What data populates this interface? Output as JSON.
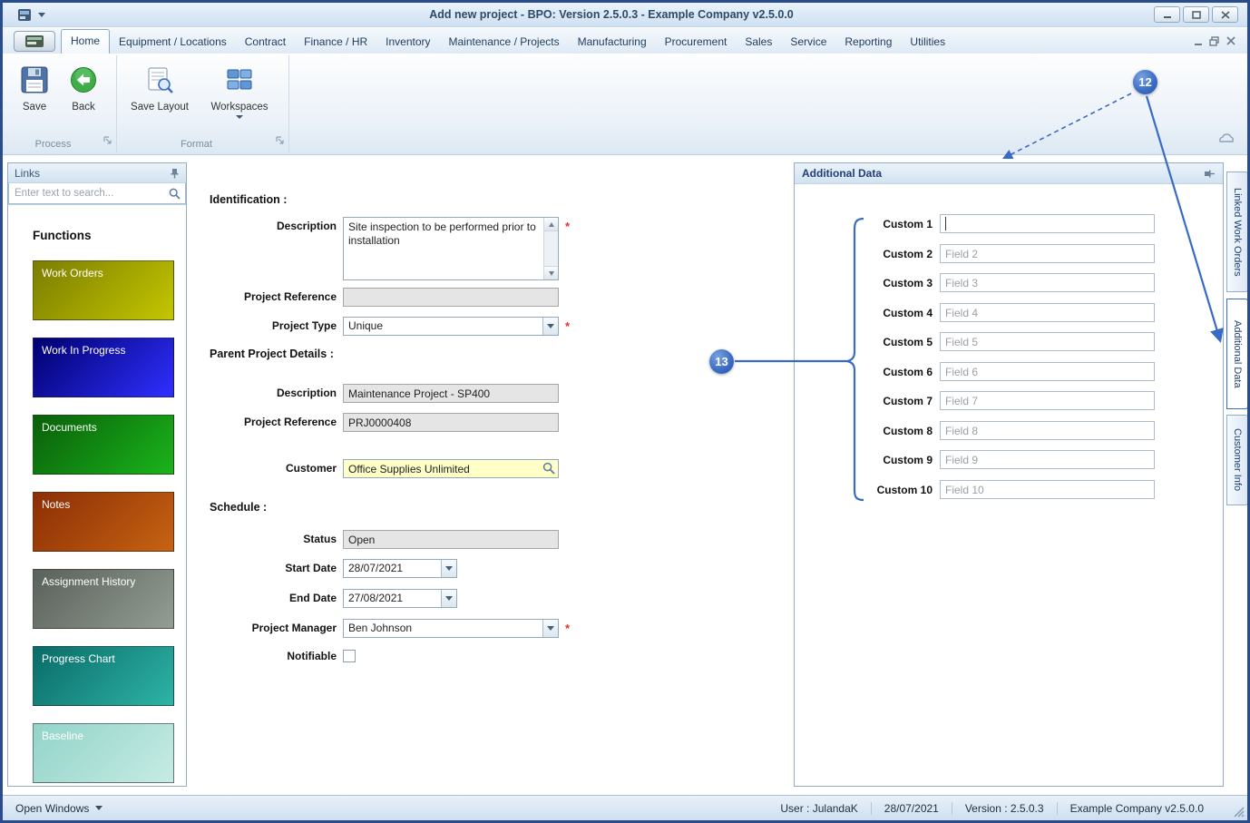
{
  "colors": {
    "annotation_blue": "#3a6bc4",
    "required_red": "#e03232",
    "panel_header_text": "#1f3f77",
    "lookup_yellow": "#ffffc8"
  },
  "window": {
    "title": "Add new project - BPO: Version 2.5.0.3 - Example Company v2.5.0.0"
  },
  "ribbon": {
    "tabs": [
      {
        "label": "Home",
        "active": true
      },
      {
        "label": "Equipment / Locations"
      },
      {
        "label": "Contract"
      },
      {
        "label": "Finance / HR"
      },
      {
        "label": "Inventory"
      },
      {
        "label": "Maintenance / Projects"
      },
      {
        "label": "Manufacturing"
      },
      {
        "label": "Procurement"
      },
      {
        "label": "Sales"
      },
      {
        "label": "Service"
      },
      {
        "label": "Reporting"
      },
      {
        "label": "Utilities"
      }
    ],
    "buttons": {
      "save": "Save",
      "back": "Back",
      "save_layout": "Save Layout",
      "workspaces": "Workspaces"
    },
    "groups": {
      "process": "Process",
      "format": "Format"
    }
  },
  "links_panel": {
    "title": "Links",
    "search_placeholder": "Enter text to search...",
    "heading": "Functions",
    "tiles": [
      {
        "label": "Work Orders",
        "from": "#7b7d00",
        "to": "#c4c600"
      },
      {
        "label": "Work In Progress",
        "from": "#00006e",
        "to": "#2f2fff"
      },
      {
        "label": "Documents",
        "from": "#0a5f0a",
        "to": "#1ab41a"
      },
      {
        "label": "Notes",
        "from": "#8c2e05",
        "to": "#c66312"
      },
      {
        "label": "Assignment History",
        "from": "#59615a",
        "to": "#949d94"
      },
      {
        "label": "Progress Chart",
        "from": "#0a6b68",
        "to": "#2db4a7"
      },
      {
        "label": "Baseline",
        "from": "#93d4c9",
        "to": "#c6ebe4"
      }
    ]
  },
  "form": {
    "sections": {
      "identification": "Identification :",
      "parent": "Parent Project Details :",
      "schedule": "Schedule :"
    },
    "description": {
      "label": "Description",
      "value": "Site inspection to be performed prior to installation",
      "required": "*"
    },
    "project_reference": {
      "label": "Project Reference",
      "value": ""
    },
    "project_type": {
      "label": "Project Type",
      "value": "Unique",
      "required": "*"
    },
    "parent_description": {
      "label": "Description",
      "value": "Maintenance Project - SP400"
    },
    "parent_reference": {
      "label": "Project Reference",
      "value": "PRJ0000408"
    },
    "customer": {
      "label": "Customer",
      "value": "Office Supplies Unlimited"
    },
    "status": {
      "label": "Status",
      "value": "Open"
    },
    "start_date": {
      "label": "Start Date",
      "value": "28/07/2021"
    },
    "end_date": {
      "label": "End Date",
      "value": "27/08/2021"
    },
    "project_manager": {
      "label": "Project Manager",
      "value": "Ben Johnson",
      "required": "*"
    },
    "notifiable": {
      "label": "Notifiable",
      "checked": false
    }
  },
  "additional_data": {
    "title": "Additional Data",
    "fields": [
      {
        "label": "Custom 1",
        "value": "",
        "placeholder": ""
      },
      {
        "label": "Custom 2",
        "value": "",
        "placeholder": "Field 2"
      },
      {
        "label": "Custom 3",
        "value": "",
        "placeholder": "Field 3"
      },
      {
        "label": "Custom 4",
        "value": "",
        "placeholder": "Field 4"
      },
      {
        "label": "Custom 5",
        "value": "",
        "placeholder": "Field 5"
      },
      {
        "label": "Custom 6",
        "value": "",
        "placeholder": "Field 6"
      },
      {
        "label": "Custom 7",
        "value": "",
        "placeholder": "Field 7"
      },
      {
        "label": "Custom 8",
        "value": "",
        "placeholder": "Field 8"
      },
      {
        "label": "Custom 9",
        "value": "",
        "placeholder": "Field 9"
      },
      {
        "label": "Custom 10",
        "value": "",
        "placeholder": "Field 10"
      }
    ]
  },
  "side_tabs": [
    {
      "label": "Linked Work Orders",
      "active": false
    },
    {
      "label": "Additional Data",
      "active": true
    },
    {
      "label": "Customer Info",
      "active": false
    }
  ],
  "annotations": {
    "callout_12": "12",
    "callout_13": "13"
  },
  "status_bar": {
    "open_windows": "Open Windows",
    "user": "User : JulandaK",
    "date": "28/07/2021",
    "version": "Version : 2.5.0.3",
    "company": "Example Company v2.5.0.0"
  }
}
